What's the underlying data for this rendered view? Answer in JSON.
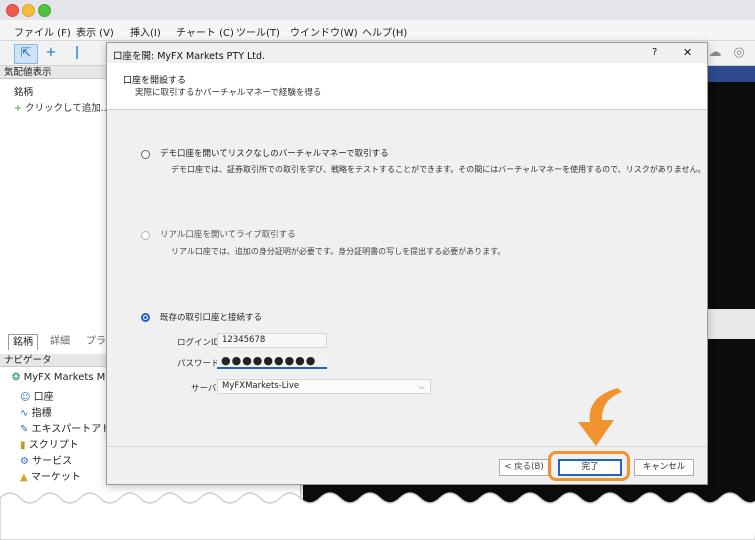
{
  "menu": [
    "ファイル (F)",
    "表示 (V)",
    "挿入(I)",
    "チャート (C)",
    "ツール(T)",
    "ウインドウ(W)",
    "ヘルプ(H)"
  ],
  "left_panel": {
    "quotes_title": "気配値表示",
    "symbol_col": "銘柄",
    "add_label": "クリックして追加...",
    "tabs": [
      "銘柄",
      "詳細",
      "プラ"
    ],
    "navigator_title": "ナビゲータ",
    "nav_items": [
      "MyFX Markets M",
      "口座",
      "指標",
      "エキスパートアド",
      "スクリプト",
      "サービス",
      "マーケット"
    ]
  },
  "dialog": {
    "title": "口座を開: MyFX Markets PTY Ltd.",
    "help": "?",
    "close": "✕",
    "heading": "口座を開設する",
    "subheading": "実際に取引するかバーチャルマネーで経験を得る",
    "options": [
      {
        "label": "デモ口座を開いてリスクなしのバーチャルマネーで取引する",
        "desc": "デモ口座では、証券取引所での取引を学び、戦略をテストすることができます。その間にはバーチャルマネーを使用するので、リスクがありません。",
        "selected": false,
        "enabled": true
      },
      {
        "label": "リアル口座を開いてライブ取引する",
        "desc": "リアル口座では、追加の身分証明が必要です。身分証明書の写しを提出する必要があります。",
        "selected": false,
        "enabled": false
      },
      {
        "label": "既存の取引口座と接続する",
        "desc": "",
        "selected": true,
        "enabled": true
      }
    ],
    "login_label": "ログインID:",
    "login_value": "12345678",
    "password_label": "パスワード:",
    "password_value": "●●●●●●●●●",
    "server_label": "サーバ:",
    "server_value": "MyFXMarkets-Live",
    "back_button": "< 戻る(B)",
    "finish_button": "完了",
    "cancel_button": "キャンセル"
  },
  "colors": {
    "accent": "#1f62c8",
    "highlight": "#f0932f",
    "chart_bg": "#0c0c0c"
  }
}
